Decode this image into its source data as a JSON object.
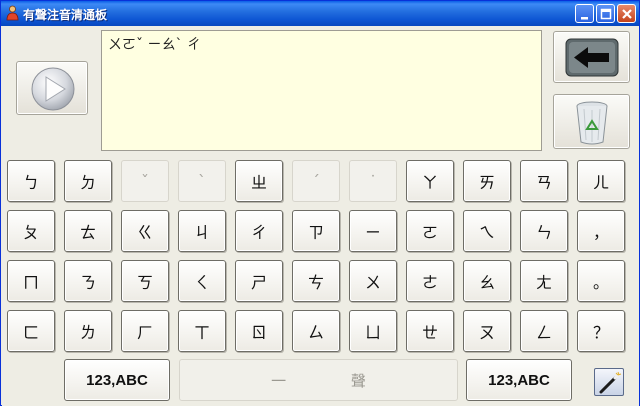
{
  "window": {
    "title": "有聲注音清通板"
  },
  "text_area": {
    "content": "ㄨㄛˇ ㄧㄠˋ ㄔ"
  },
  "keys": {
    "row1": [
      "ㄅ",
      "ㄉ",
      "ˇ",
      "ˋ",
      "ㄓ",
      "ˊ",
      "˙",
      "ㄚ",
      "ㄞ",
      "ㄢ",
      "ㄦ"
    ],
    "row2": [
      "ㄆ",
      "ㄊ",
      "ㄍ",
      "ㄐ",
      "ㄔ",
      "ㄗ",
      "ㄧ",
      "ㄛ",
      "ㄟ",
      "ㄣ",
      "，"
    ],
    "row3": [
      "ㄇ",
      "ㄋ",
      "ㄎ",
      "ㄑ",
      "ㄕ",
      "ㄘ",
      "ㄨ",
      "ㄜ",
      "ㄠ",
      "ㄤ",
      "。"
    ],
    "row4": [
      "ㄈ",
      "ㄌ",
      "ㄏ",
      "ㄒ",
      "ㄖ",
      "ㄙ",
      "ㄩ",
      "ㄝ",
      "ㄡ",
      "ㄥ",
      "？"
    ]
  },
  "bottom": {
    "left_mode_label": "123,ABC",
    "right_mode_label": "123,ABC",
    "space_label": "一 聲"
  },
  "icons": {
    "app": "speaker-person-icon",
    "play": "play-icon",
    "backspace": "backspace-arrow-icon",
    "clear": "recycle-bin-icon",
    "settings": "wand-icon"
  },
  "colors": {
    "textarea_bg": "#FFFFE1",
    "titlebar": "#0A5FE6"
  }
}
